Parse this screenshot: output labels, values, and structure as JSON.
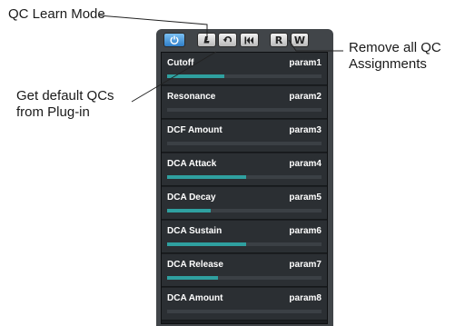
{
  "callouts": {
    "learn_mode": "QC Learn Mode",
    "default_qcs_line1": "Get default QCs",
    "default_qcs_line2": "from Plug-in",
    "remove_all_line1": "Remove all QC",
    "remove_all_line2": "Assignments"
  },
  "toolbar": {
    "buttons": [
      {
        "name": "power-button",
        "icon": "power-icon",
        "active": true
      },
      {
        "name": "learn-mode-button",
        "icon": "learn-mode-icon"
      },
      {
        "name": "default-qcs-button",
        "icon": "undo-arrow-icon"
      },
      {
        "name": "remove-all-button",
        "icon": "skip-back-icon"
      },
      {
        "name": "read-button",
        "label": "R"
      },
      {
        "name": "write-button",
        "label": "W"
      }
    ]
  },
  "qc_list": [
    {
      "name": "Cutoff",
      "param": "param1",
      "level": 0.37
    },
    {
      "name": "Resonance",
      "param": "param2",
      "level": 0.0
    },
    {
      "name": "DCF Amount",
      "param": "param3",
      "level": 0.0
    },
    {
      "name": "DCA Attack",
      "param": "param4",
      "level": 0.51
    },
    {
      "name": "DCA Decay",
      "param": "param5",
      "level": 0.28
    },
    {
      "name": "DCA Sustain",
      "param": "param6",
      "level": 0.51
    },
    {
      "name": "DCA Release",
      "param": "param7",
      "level": 0.33
    },
    {
      "name": "DCA Amount",
      "param": "param8",
      "level": 0.0
    }
  ],
  "colors": {
    "panel": "#414549",
    "row": "#2b2f33",
    "fill": "#2fa0a0",
    "power_active": "#2f7fc9"
  }
}
